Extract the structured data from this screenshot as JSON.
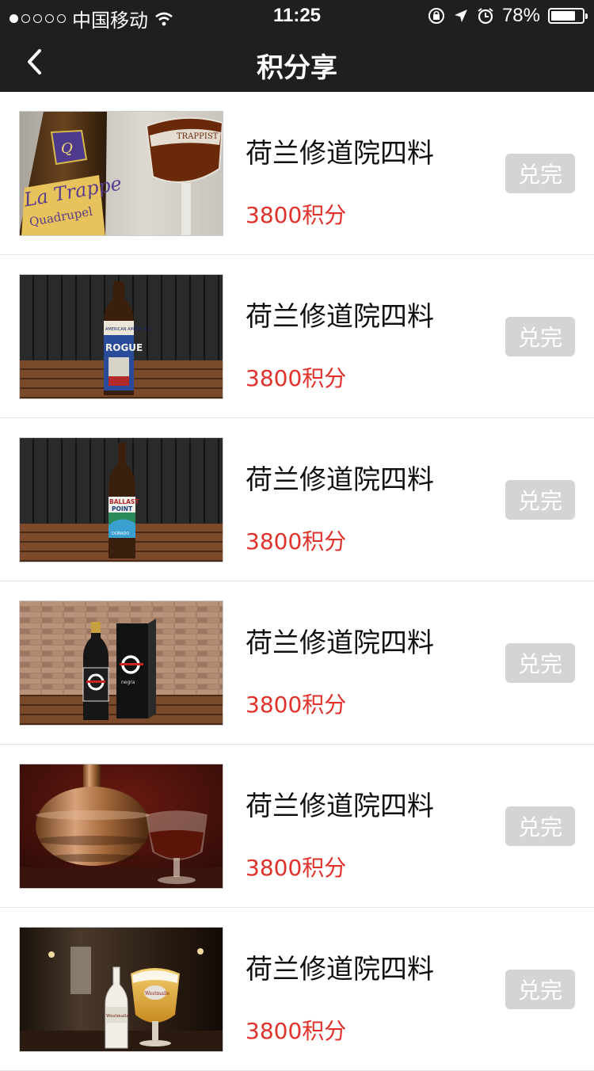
{
  "status": {
    "carrier": "中国移动",
    "time": "11:25",
    "battery": "78%",
    "battery_level": 0.78
  },
  "header": {
    "title": "积分享"
  },
  "items": [
    {
      "name": "荷兰修道院四料",
      "points": "3800积分",
      "button": "兑完"
    },
    {
      "name": "荷兰修道院四料",
      "points": "3800积分",
      "button": "兑完"
    },
    {
      "name": "荷兰修道院四料",
      "points": "3800积分",
      "button": "兑完"
    },
    {
      "name": "荷兰修道院四料",
      "points": "3800积分",
      "button": "兑完"
    },
    {
      "name": "荷兰修道院四料",
      "points": "3800积分",
      "button": "兑完"
    },
    {
      "name": "荷兰修道院四料",
      "points": "3800积分",
      "button": "兑完"
    }
  ],
  "thumb_labels": {
    "item0": [
      "La Trappe",
      "Quadrupel",
      "TRAPPIST"
    ],
    "item1": [
      "AMERICAN AMBER ALE",
      "ROGUE"
    ],
    "item2": [
      "BALLAST",
      "POINT",
      "DORADO"
    ],
    "item3": [
      "negra"
    ],
    "item5": [
      "Westmalle",
      "TRAPPIST"
    ]
  },
  "colors": {
    "bar": "#1f1f1f",
    "price": "#e0322b",
    "button": "#d4d4d4"
  }
}
